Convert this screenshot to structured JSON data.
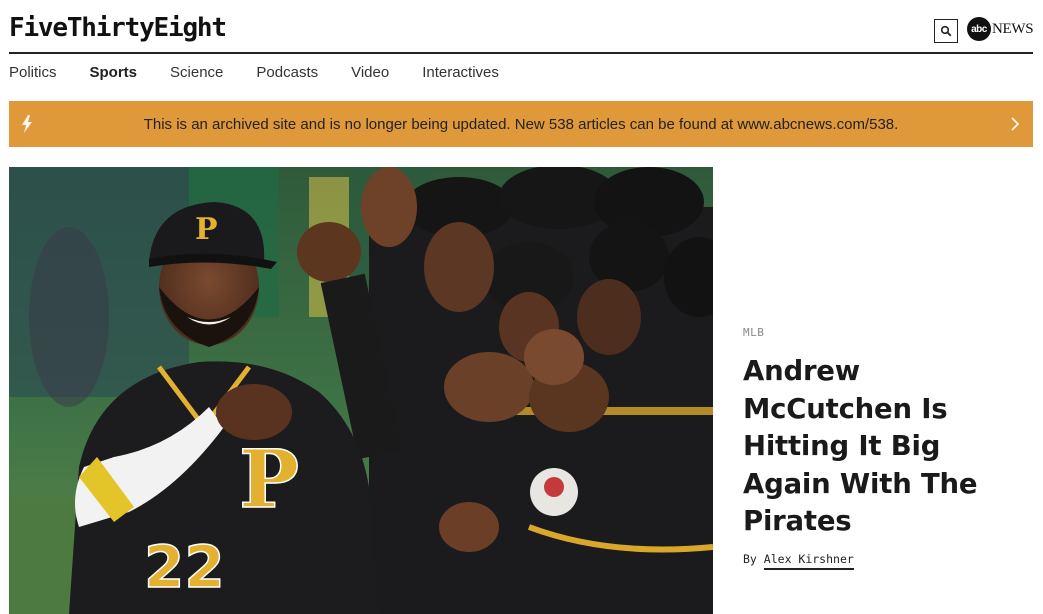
{
  "header": {
    "logo": "FiveThirtyEight",
    "partner_logo_mark": "abc",
    "partner_logo_text": "NEWS"
  },
  "nav": {
    "items": [
      {
        "label": "Politics",
        "active": false
      },
      {
        "label": "Sports",
        "active": true
      },
      {
        "label": "Science",
        "active": false
      },
      {
        "label": "Podcasts",
        "active": false
      },
      {
        "label": "Video",
        "active": false
      },
      {
        "label": "Interactives",
        "active": false
      }
    ]
  },
  "banner": {
    "message": "This is an archived site and is no longer being updated. New 538 articles can be found at www.abcnews.com/538.",
    "color": "#e0993a"
  },
  "article": {
    "kicker": "MLB",
    "headline": "Andrew McCutchen Is Hitting It Big Again With The Pirates",
    "byline_prefix": "By",
    "author": "Alex Kirshner"
  },
  "hero": {
    "jersey_letter": "P",
    "jersey_number": "22"
  },
  "icons": {
    "search": "search-icon",
    "bolt": "bolt-icon",
    "chevron": "chevron-right-icon"
  }
}
